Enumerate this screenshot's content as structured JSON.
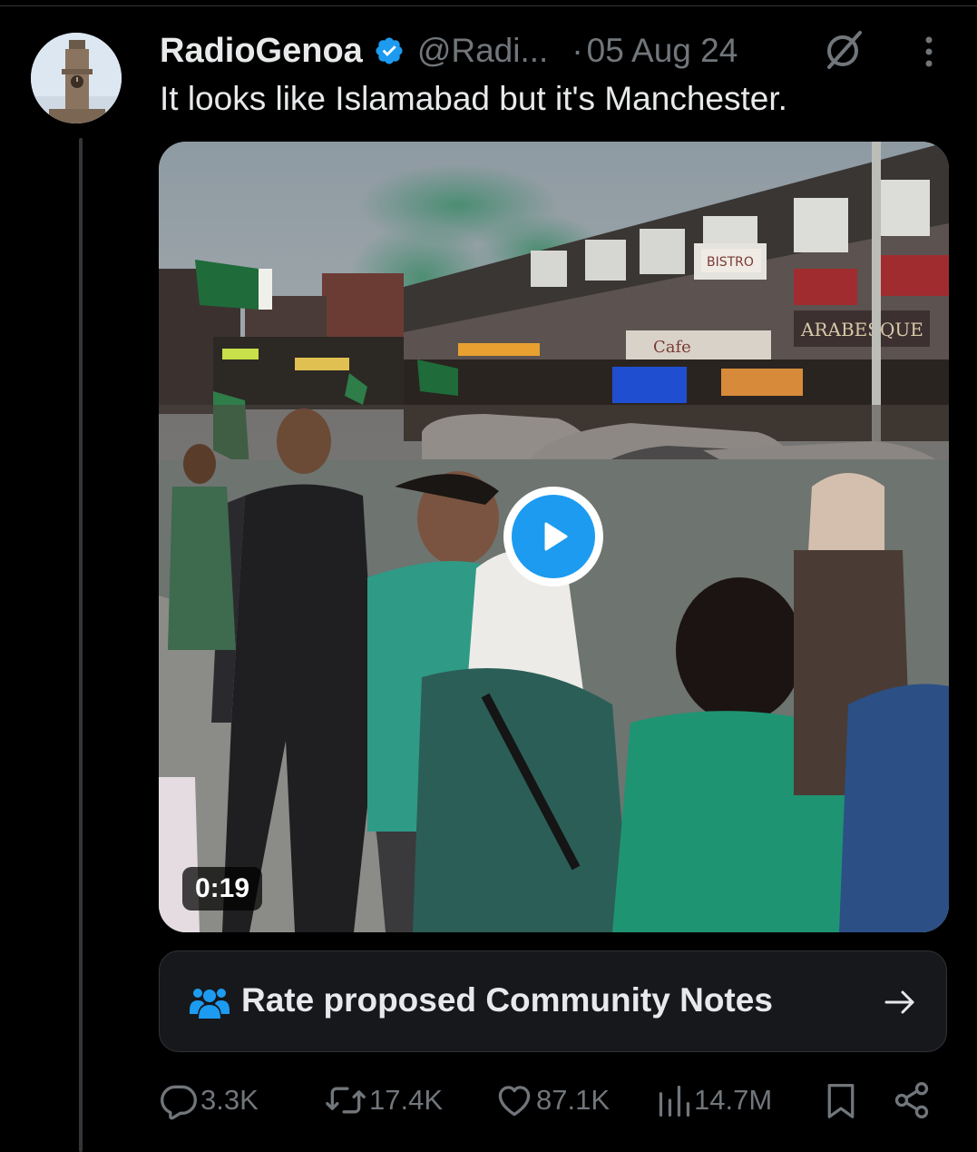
{
  "tweet": {
    "display_name": "RadioGenoa",
    "handle": "@Radi...",
    "separator": "·",
    "date": "05 Aug 24",
    "text": "It looks like Islamabad but it's Manchester."
  },
  "media": {
    "duration": "0:19",
    "signage": {
      "arabesque": "ARABESQUE",
      "cafe": "Cafe",
      "bistro": "BISTRO"
    }
  },
  "community_notes": {
    "label": "Rate proposed Community Notes"
  },
  "actions": {
    "replies": "3.3K",
    "reposts": "17.4K",
    "likes": "87.1K",
    "views": "14.7M"
  },
  "colors": {
    "background": "#000000",
    "text_primary": "#e7e9ea",
    "text_secondary": "#71767b",
    "accent": "#1d9bf0",
    "card_bg": "#16181c",
    "border": "#2f3336"
  },
  "icons": {
    "verified": "verified-badge-icon",
    "grok": "grok-icon",
    "more": "more-vertical-icon",
    "play": "play-icon",
    "notes": "people-icon",
    "arrow": "arrow-right-icon",
    "reply": "reply-icon",
    "repost": "repost-icon",
    "like": "heart-icon",
    "views": "views-icon",
    "bookmark": "bookmark-icon",
    "share": "share-icon"
  }
}
